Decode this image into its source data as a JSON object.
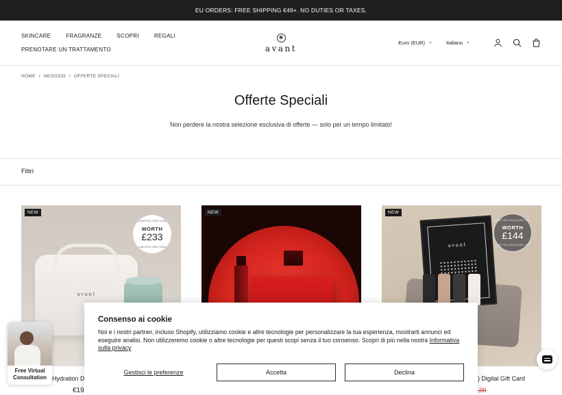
{
  "announcement": "EU ORDERS: FREE SHIPPING €49+. NO DUTIES OR TAXES.",
  "nav": {
    "items": [
      "SKINCARE",
      "FRAGRANZE",
      "SCOPRI",
      "REGALI"
    ],
    "second_row": "PRENOTARE UN TRATTAMENTO"
  },
  "logo": "avant",
  "header_right": {
    "currency": "Euro (EUR)",
    "language": "Italiano",
    "icons": [
      "account-icon",
      "search-icon",
      "bag-icon"
    ]
  },
  "breadcrumb": [
    "HOME",
    "NEGOZIO",
    "OFFERTE SPECIALI"
  ],
  "page": {
    "title": "Offerte Speciali",
    "subtitle": "Non perdere la nostra selezione esclusiva di offerte — solo per un tempo limitato!"
  },
  "filter": "Filtri",
  "products": [
    {
      "badge": "NEW",
      "worth_label": "WORTH",
      "worth_value": "£233",
      "edition_text": "LIMITED EDITION",
      "title_visible": "Hydration D",
      "price_visible": "€19"
    },
    {
      "badge": "NEW",
      "title_visible": "",
      "price_visible": ""
    },
    {
      "badge": "NEW",
      "worth_label": "WORTH",
      "worth_value": "£144",
      "edition_text": "LIMITED AVAILABILITY",
      "title_visible": ") Digital Gift Card",
      "price_visible": ",00"
    }
  ],
  "cookie": {
    "title": "Consenso ai cookie",
    "text": "Noi e i nostri partner, incluso Shopify, utilizziamo cookie e altre tecnologie per personalizzare la tua esperienza, mostrarti annunci ed eseguire analisi. Non utilizzeremo cookie o altre tecnologie per questi scopi senza il tuo consenso. Scopri di più nella nostra",
    "link": "Informativa sulla privacy",
    "manage": "Gestisci le preferenze",
    "accept": "Accetta",
    "decline": "Declina"
  },
  "consultation": "Free Virtual Consultation",
  "colors": {
    "announcement_bg": "#1f1f1f",
    "badge_bg": "#1b1b1b",
    "price_strike": "#c0392b"
  }
}
